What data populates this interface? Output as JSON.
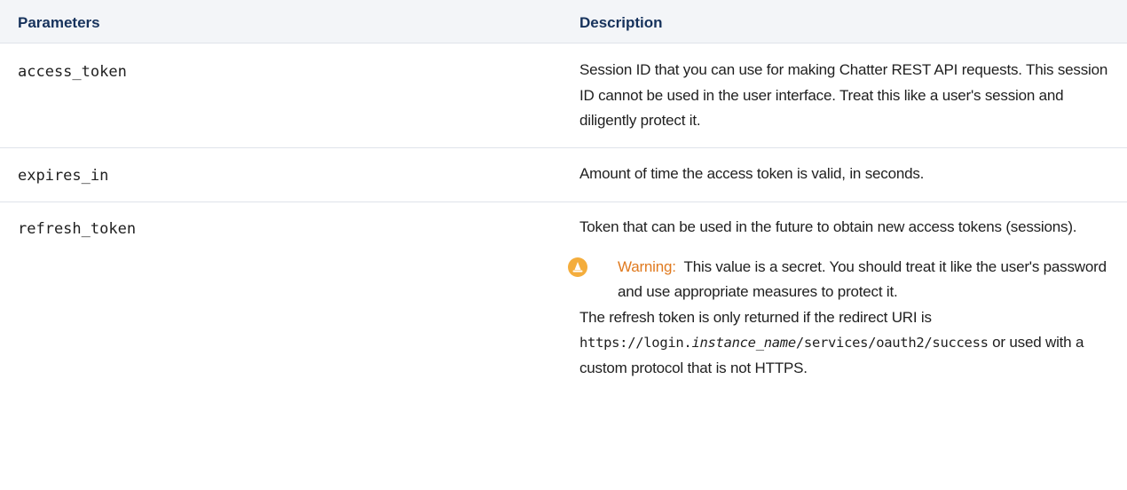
{
  "table": {
    "headers": {
      "parameters": "Parameters",
      "description": "Description"
    },
    "rows": [
      {
        "param": "access_token",
        "description": "Session ID that you can use for making Chatter REST API requests. This session ID cannot be used in the user interface. Treat this like a user's session and diligently protect it."
      },
      {
        "param": "expires_in",
        "description": "Amount of time the access token is valid, in seconds."
      },
      {
        "param": "refresh_token",
        "description": "Token that can be used in the future to obtain new access tokens (sessions).",
        "warning": {
          "icon": "warning-cone-icon",
          "label": "Warning:",
          "text": "This value is a secret. You should treat it like the user's password and use appropriate measures to protect it."
        },
        "note": {
          "before": "The refresh token is only returned if the redirect URI is",
          "uri_prefix": "https://login.",
          "uri_var": "instance_name",
          "uri_suffix": "/services/oauth2/success",
          "after": "or used with a custom protocol that is not HTTPS."
        }
      }
    ]
  },
  "colors": {
    "header_bg": "#f3f5f8",
    "border": "#dfe3ea",
    "warning_label": "#e07a1f",
    "warning_icon": "#f4ad3c"
  }
}
